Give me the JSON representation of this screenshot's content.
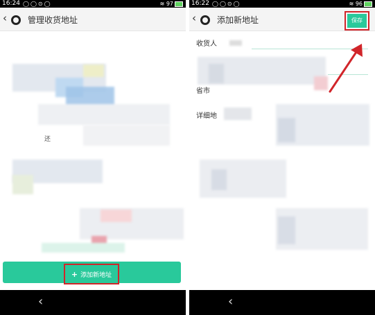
{
  "left_screen": {
    "status_time": "16:24",
    "battery": "97",
    "title": "管理收货地址",
    "add_button_label": "添加新地址",
    "partial_text": "还"
  },
  "right_screen": {
    "status_time": "16:22",
    "battery": "96",
    "title": "添加新地址",
    "save_label": "保存",
    "fields": {
      "receiver_label": "收货人",
      "region_label": "省市",
      "detail_label": "详细地"
    }
  },
  "colors": {
    "accent": "#29c99b",
    "highlight": "#d1252a"
  }
}
